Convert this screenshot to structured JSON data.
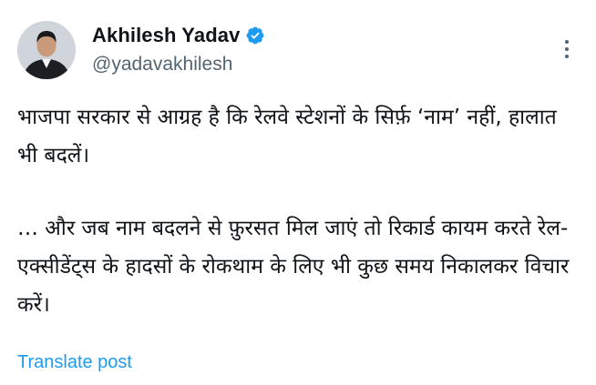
{
  "author": {
    "display_name": "Akhilesh Yadav",
    "handle": "@yadavakhilesh",
    "verified": true,
    "avatar_icon": "profile-photo"
  },
  "post": {
    "paragraph_1": "भाजपा सरकार से आग्रह है कि रेलवे स्टेशनों के सिर्फ़ ‘नाम’ नहीं, हालात भी बदलें।",
    "paragraph_2": "… और जब नाम बदलने से फ़ुरसत मिल जाएं तो रिकार्ड कायम करते रेल-एक्सीडेंट्स के हादसों के रोकथाम के लिए भी कुछ समय निकालकर विचार करें।"
  },
  "actions": {
    "translate_label": "Translate post",
    "more_icon": "more-vertical-icon"
  },
  "colors": {
    "accent": "#1d9bf0",
    "text": "#0f1419",
    "muted": "#536471"
  }
}
